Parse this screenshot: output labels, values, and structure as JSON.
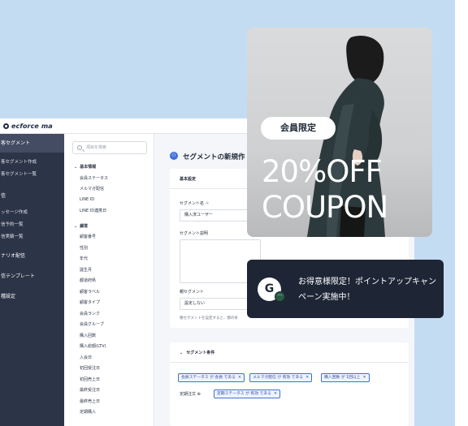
{
  "app": {
    "logo_text": "ecforce ma"
  },
  "sidebar": {
    "items": [
      {
        "label": "客セグメント",
        "active": true
      },
      {
        "label": "客セグメント作成"
      },
      {
        "label": "客セグメント一覧"
      },
      {
        "label": "信"
      },
      {
        "label": "ッセージ作成"
      },
      {
        "label": "信予約一覧"
      },
      {
        "label": "信実績一覧"
      },
      {
        "label": "ナリオ配信"
      },
      {
        "label": "信テンプレート"
      },
      {
        "label": "種設定"
      }
    ]
  },
  "filter_panel": {
    "search_placeholder": "項目を検索",
    "groups": [
      {
        "heading": "基本情報",
        "items": [
          "会員ステータス",
          "メルマガ配信",
          "LINE ID",
          "LINE ID連携日"
        ]
      },
      {
        "heading": "顧客",
        "items": [
          "顧客番号",
          "性別",
          "年代",
          "誕生月",
          "都道府県",
          "顧客ラベル",
          "顧客タイプ",
          "会員ランク",
          "会員グループ",
          "購入回数",
          "購入総額(LTV)",
          "入会日",
          "初回受注日",
          "初回売上日",
          "最終受注日",
          "最終売上日",
          "定期購入"
        ]
      }
    ]
  },
  "main": {
    "title": "セグメントの新規作",
    "basic": {
      "heading": "基本設定",
      "name_label": "セグメント名",
      "name_required_mark": "※",
      "name_value": "購入済ユーザー",
      "desc_label": "セグメント説明",
      "parent_label": "親セグメント",
      "parent_value": "設定しない",
      "parent_hint": "親セグメントを設定すると、親の条"
    },
    "conditions": {
      "heading": "セグメント条件",
      "chips_row1": [
        "会員ステータス が 会員 である",
        "メルマガ配信 が 有効 である",
        "購入回数 が 1回以上"
      ],
      "row2_label": "定期注文",
      "row2_mark": "⊕",
      "chips_row2": [
        "定期ステータス が 有効 である"
      ]
    }
  },
  "coupon": {
    "badge": "会員限定",
    "line1": "20%OFF",
    "line2": "COUPON"
  },
  "notification": {
    "avatar_letter": "G",
    "badge_glyph": "···",
    "message": "お得意様限定！ポイントアップキャンペーン実施中！"
  },
  "colors": {
    "background_blue": "#c4dcf2",
    "sidebar": "#2c3447",
    "accent": "#3f6fd8",
    "notice_bg": "#1e2636"
  }
}
